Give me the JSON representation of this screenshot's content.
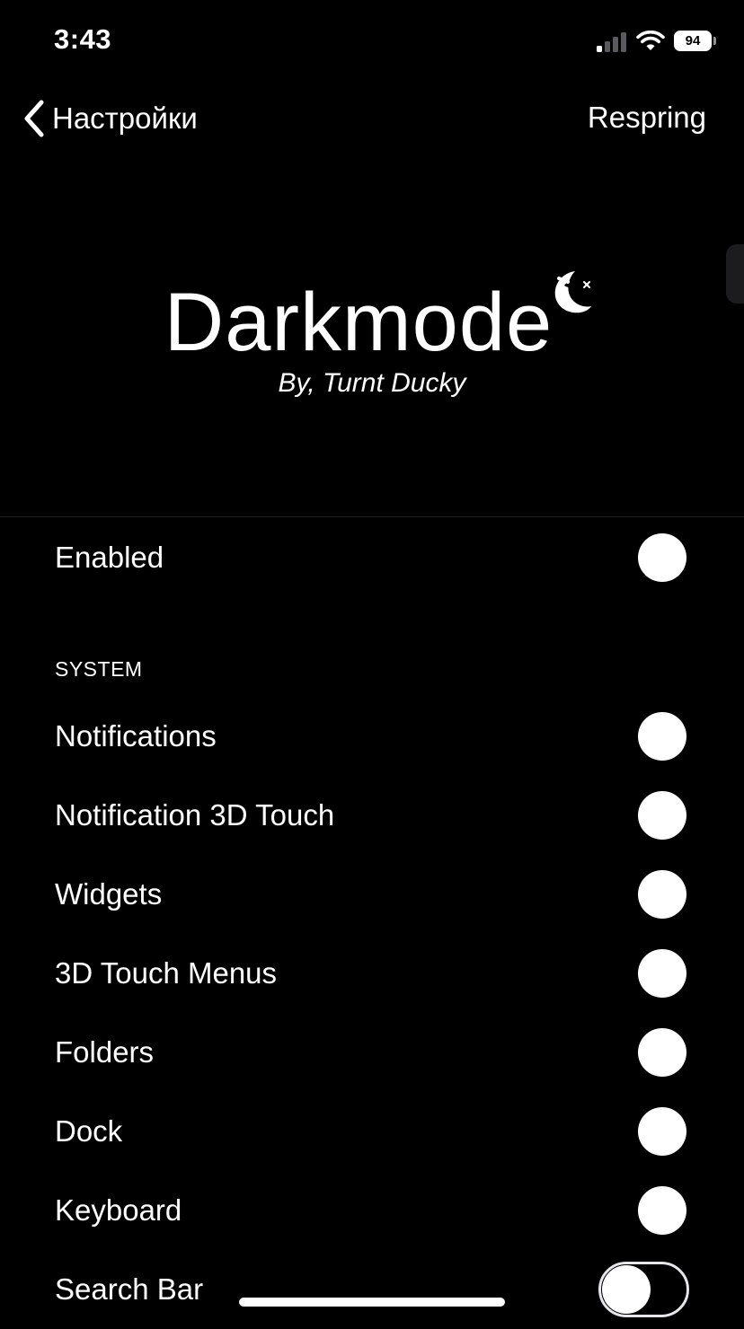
{
  "status_bar": {
    "time": "3:43",
    "battery": "94",
    "icons": [
      "signal-icon",
      "wifi-icon",
      "battery-icon"
    ]
  },
  "nav": {
    "back_label": "Настройки",
    "back_icon": "chevron-left-icon",
    "right_action": "Respring"
  },
  "header": {
    "title": "Darkmode",
    "subtitle": "By, Turnt Ducky",
    "logo_icon": "moon-duck-icon"
  },
  "enabled_row": {
    "label": "Enabled",
    "on": true
  },
  "sections": [
    {
      "header": "SYSTEM",
      "items": [
        {
          "label": "Notifications",
          "on": true
        },
        {
          "label": "Notification 3D Touch",
          "on": true
        },
        {
          "label": "Widgets",
          "on": true
        },
        {
          "label": "3D Touch Menus",
          "on": true
        },
        {
          "label": "Folders",
          "on": true
        },
        {
          "label": "Dock",
          "on": true
        },
        {
          "label": "Keyboard",
          "on": true
        },
        {
          "label": "Search Bar",
          "on": false
        }
      ]
    }
  ],
  "colors": {
    "background": "#000000",
    "text": "#ffffff",
    "switch_border": "#e5e5ea"
  }
}
